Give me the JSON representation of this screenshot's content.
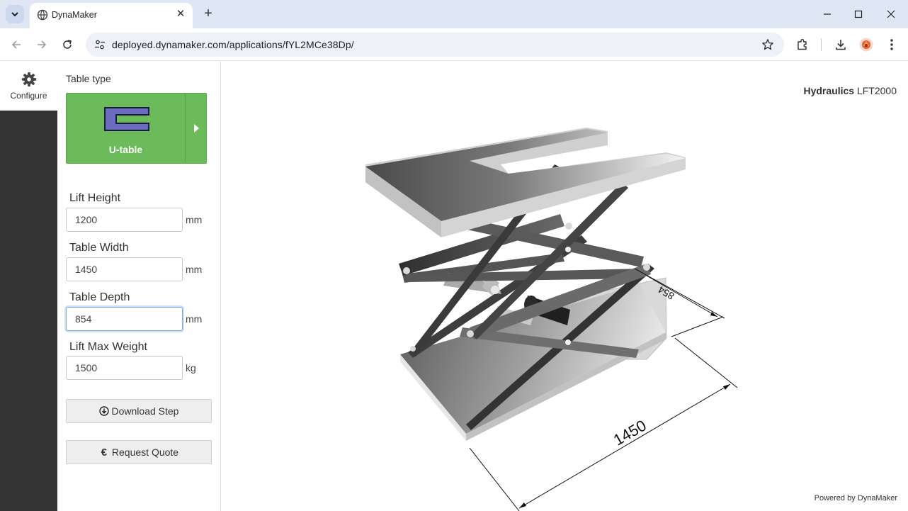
{
  "browser": {
    "tab_title": "DynaMaker",
    "url": "deployed.dynamaker.com/applications/fYL2MCe38Dp/",
    "icons": [
      "tab-search-icon",
      "favicon-globe-icon",
      "close-icon",
      "new-tab-icon",
      "minimize-icon",
      "maximize-icon",
      "window-close-icon",
      "back-icon",
      "forward-icon",
      "reload-icon",
      "site-settings-icon",
      "bookmark-star-icon",
      "extensions-icon",
      "download-icon",
      "profile-avatar",
      "more-menu-icon"
    ]
  },
  "rail": {
    "configure_label": "Configure",
    "icon": "gear-icon"
  },
  "panel": {
    "table_type_label": "Table type",
    "table_type_value": "U-table",
    "table_type_color": "#6cbb5a",
    "shape_color": "#6b6bc0",
    "fields": [
      {
        "label": "Lift Height",
        "value": "1200",
        "unit": "mm"
      },
      {
        "label": "Table Width",
        "value": "1450",
        "unit": "mm"
      },
      {
        "label": "Table Depth",
        "value": "854",
        "unit": "mm"
      },
      {
        "label": "Lift Max Weight",
        "value": "1500",
        "unit": "kg"
      }
    ],
    "download_label": "Download Step",
    "download_icon": "download-circle-icon",
    "quote_label": "Request Quote",
    "quote_icon": "euro-icon"
  },
  "viewport": {
    "brand_name": "Hydraulics",
    "brand_model": "LFT2000",
    "powered_by": "Powered by DynaMaker",
    "dimension_width": "1450",
    "dimension_depth": "854"
  }
}
